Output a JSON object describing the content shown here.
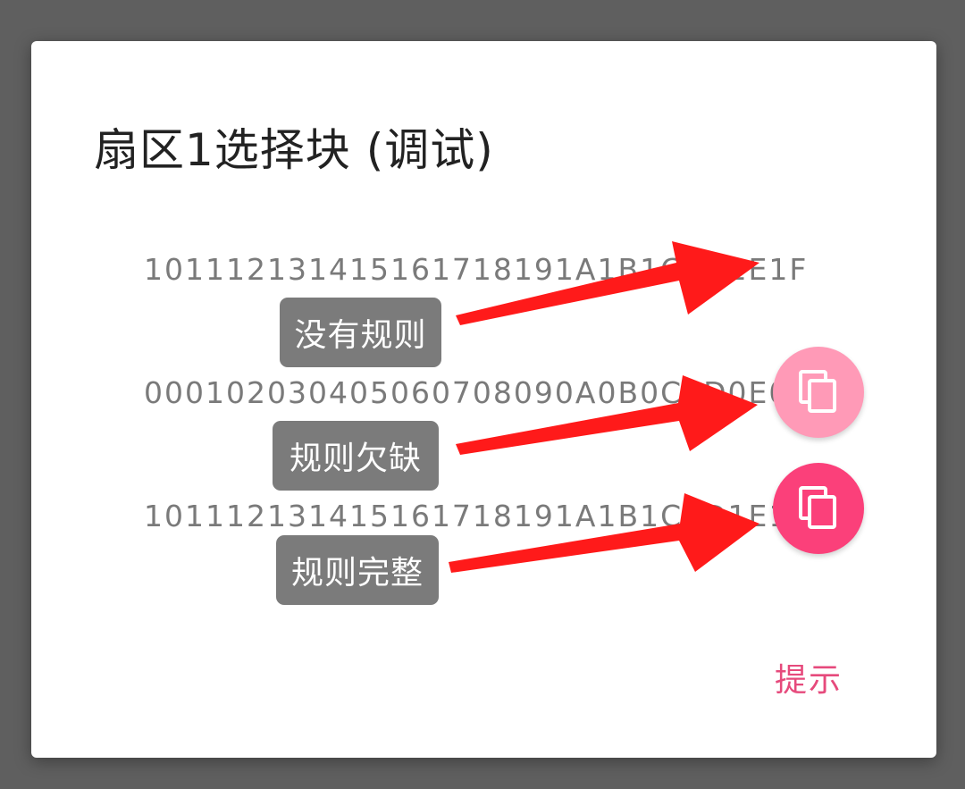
{
  "dialog": {
    "title": "扇区1选择块 (调试)",
    "hint_label": "提示"
  },
  "blocks": [
    {
      "hex": "101112131415161718191A1B1C1D1E1F"
    },
    {
      "hex": "000102030405060708090A0B0C0D0E0F"
    },
    {
      "hex": "101112131415161718191A1B1C1D1E1F"
    }
  ],
  "icons": {
    "copy_faded": "copy-icon",
    "copy_full": "copy-icon"
  },
  "annotations": {
    "label_1": "没有规则",
    "label_2": "规则欠缺",
    "label_3": "规则完整"
  },
  "colors": {
    "scrim": "#5f5f5f",
    "dialog_bg": "#ffffff",
    "accent": "#fb407a",
    "accent_faded": "#ff9ab7",
    "hint_text": "#e64a7c",
    "annotation_label_bg": "#7b7b7b",
    "annotation_arrow": "#ff1a1a"
  }
}
